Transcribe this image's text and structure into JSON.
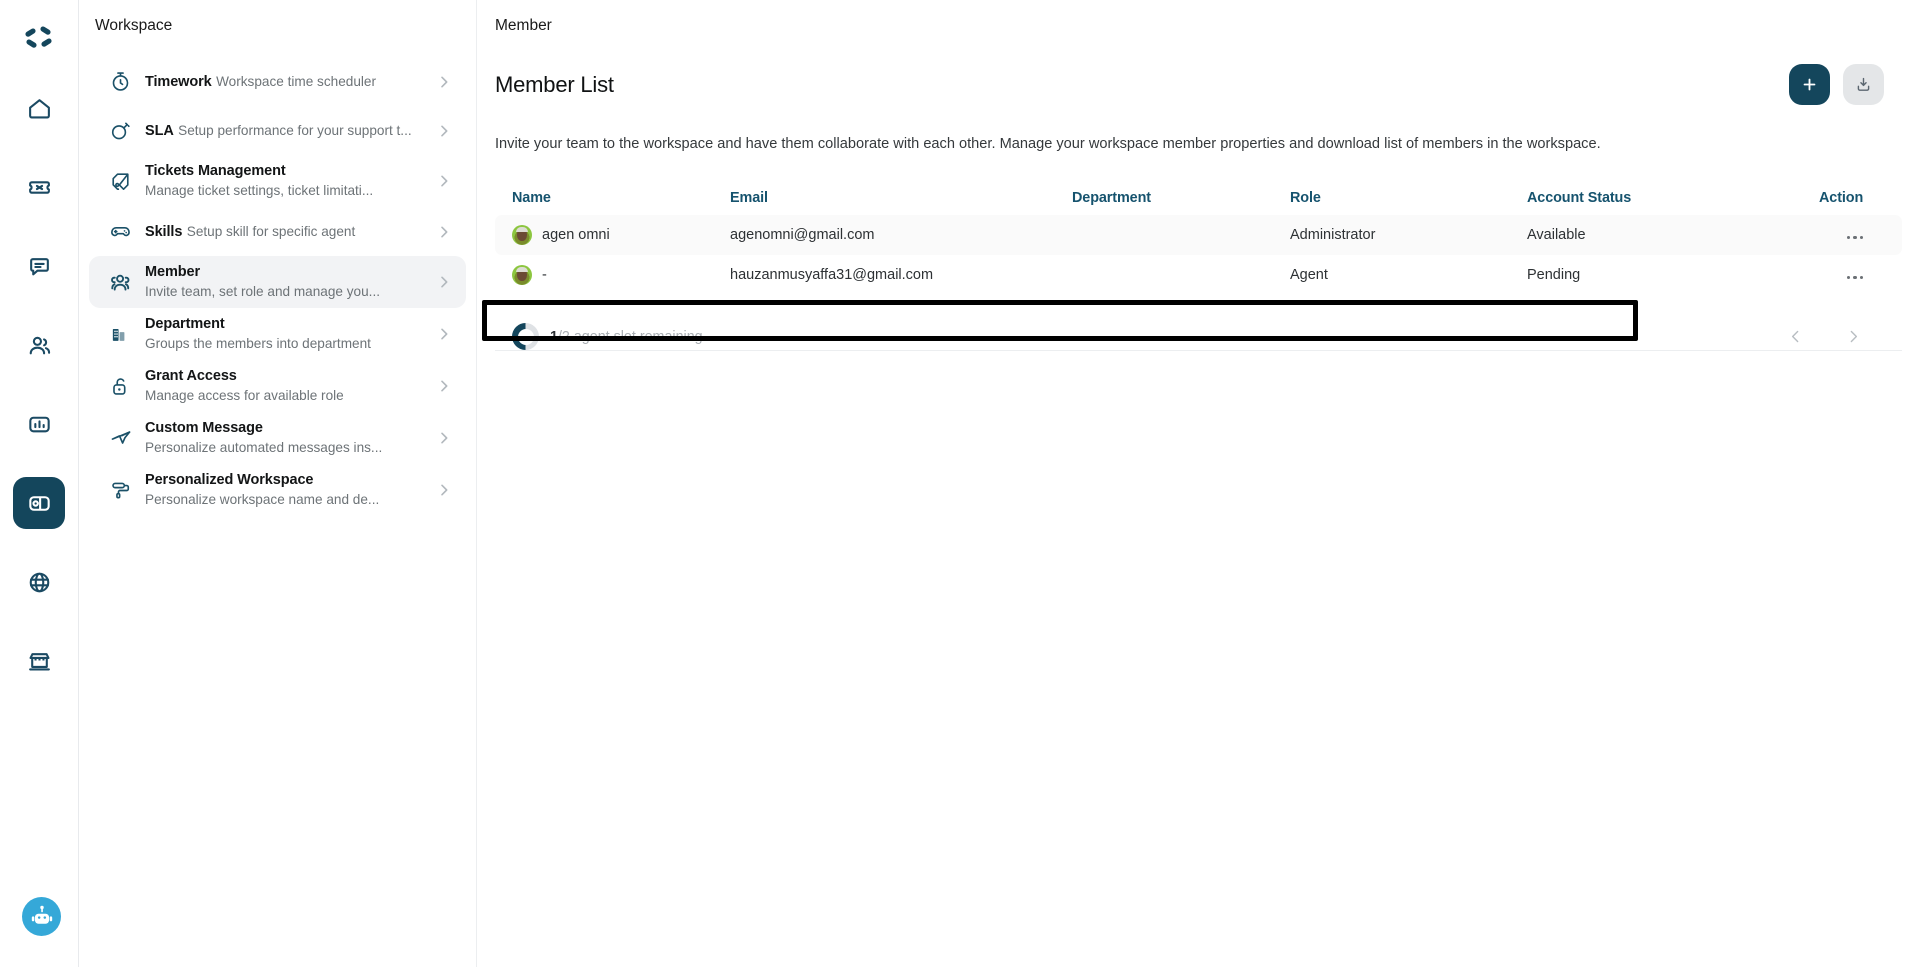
{
  "rail": {
    "logo_icon": "app-logo-icon",
    "items": [
      {
        "icon": "home-icon",
        "name": "rail-item-home",
        "active": false
      },
      {
        "icon": "ticket-icon",
        "name": "rail-item-ticket",
        "active": false
      },
      {
        "icon": "chat-bubble-icon",
        "name": "rail-item-chat",
        "active": false
      },
      {
        "icon": "contacts-icon",
        "name": "rail-item-contacts",
        "active": false
      },
      {
        "icon": "analytics-icon",
        "name": "rail-item-analytics",
        "active": false
      },
      {
        "icon": "workspace-icon",
        "name": "rail-item-workspace",
        "active": true
      },
      {
        "icon": "globe-icon",
        "name": "rail-item-channels",
        "active": false
      },
      {
        "icon": "store-icon",
        "name": "rail-item-marketplace",
        "active": false
      }
    ],
    "bot_icon": "robot-assistant-icon"
  },
  "sidebar": {
    "title": "Workspace",
    "items": [
      {
        "label": "Timework",
        "desc": "Workspace time scheduler",
        "icon": "stopwatch-icon",
        "selected": false
      },
      {
        "label": "SLA",
        "desc": "Setup performance for your support t...",
        "icon": "sla-target-icon",
        "selected": false
      },
      {
        "label": "Tickets Management",
        "desc": "Manage ticket settings, ticket limitati...",
        "icon": "ticket-tag-icon",
        "selected": false
      },
      {
        "label": "Skills",
        "desc": "Setup skill for specific agent",
        "icon": "gamepad-icon",
        "selected": false
      },
      {
        "label": "Member",
        "desc": "Invite team, set role and manage you...",
        "icon": "members-group-icon",
        "selected": true
      },
      {
        "label": "Department",
        "desc": "Groups the members into department",
        "icon": "building-icon",
        "selected": false
      },
      {
        "label": "Grant Access",
        "desc": "Manage access for available role",
        "icon": "unlock-icon",
        "selected": false
      },
      {
        "label": "Custom Message",
        "desc": "Personalize automated messages ins...",
        "icon": "send-cursor-icon",
        "selected": false
      },
      {
        "label": "Personalized Workspace",
        "desc": "Personalize workspace name and de...",
        "icon": "paint-roller-icon",
        "selected": false
      }
    ]
  },
  "main": {
    "breadcrumb": "Member",
    "page_title": "Member List",
    "description": "Invite your team to the workspace and have them collaborate with each other. Manage your workspace member properties and download list of members in the workspace.",
    "add_button_icon": "plus-icon",
    "download_button_icon": "download-icon",
    "table": {
      "columns": [
        "Name",
        "Email",
        "Department",
        "Role",
        "Account Status",
        "Action"
      ],
      "rows": [
        {
          "name": "agen omni",
          "email": "agenomni@gmail.com",
          "department": "",
          "role": "Administrator",
          "status": "Available",
          "action_icon": "more-options-icon"
        },
        {
          "name": "-",
          "email": "hauzanmusyaffa31@gmail.com",
          "department": "",
          "role": "Agent",
          "status": "Pending",
          "action_icon": "more-options-icon"
        }
      ]
    },
    "footer": {
      "slot_current": "1",
      "slot_rest": "/2 agent slot remaining",
      "prev_icon": "chevron-left-icon",
      "next_icon": "chevron-right-icon"
    }
  },
  "colors": {
    "brand_dark": "#14465c",
    "header_text": "#16536e",
    "bot_blue": "#35a8d8",
    "highlight_border": "#000000"
  }
}
